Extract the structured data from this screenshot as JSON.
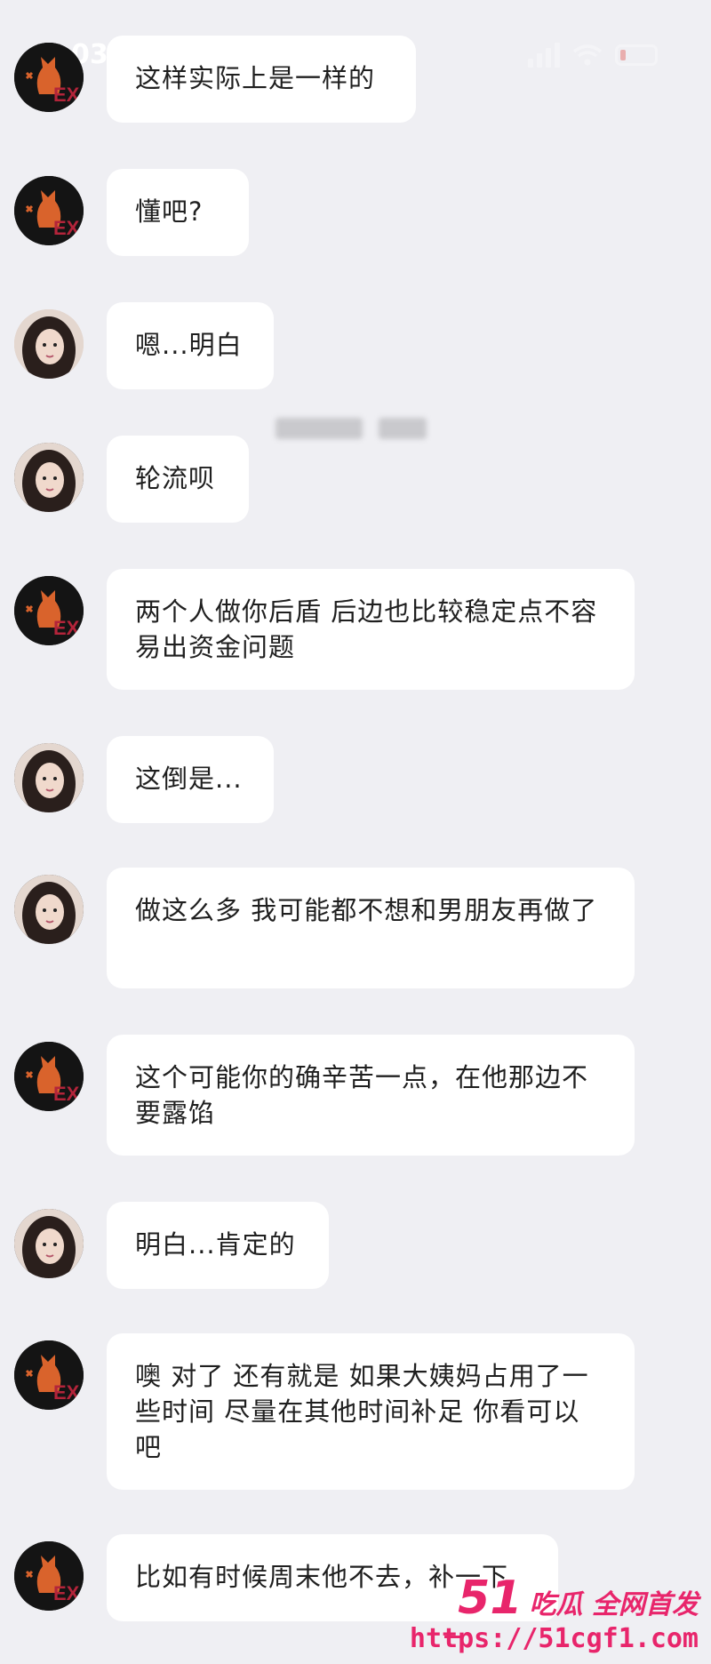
{
  "status_bar": {
    "time": "03"
  },
  "messages": [
    {
      "sender": "cat",
      "text": "这样实际上是一样的"
    },
    {
      "sender": "girl",
      "text": "懂吧?"
    },
    {
      "sender": "girl",
      "text": "嗯...明白"
    },
    {
      "sender": "girl",
      "text": "轮流呗"
    },
    {
      "sender": "cat",
      "text": "两个人做你后盾 后边也比较稳定点不容易出资金问题"
    },
    {
      "sender": "girl",
      "text": "这倒是..."
    },
    {
      "sender": "girl",
      "text": "做这么多 我可能都不想和男朋友再做了"
    },
    {
      "sender": "cat",
      "text": "这个可能你的确辛苦一点，在他那边不要露馅"
    },
    {
      "sender": "girl",
      "text": "明白...肯定的"
    },
    {
      "sender": "cat",
      "text": "噢 对了 还有就是 如果大姨妈占用了一些时间 尽量在其他时间补足 你看可以吧"
    },
    {
      "sender": "cat",
      "text": "比如有时候周末他不去，补一下"
    }
  ],
  "watermark": {
    "brand": "51",
    "slogan": "吃瓜 全网首发",
    "url": "https://51cgf1.com"
  },
  "colors": {
    "accent": "#e8256b",
    "background": "#efeff3",
    "bubble": "#ffffff"
  }
}
